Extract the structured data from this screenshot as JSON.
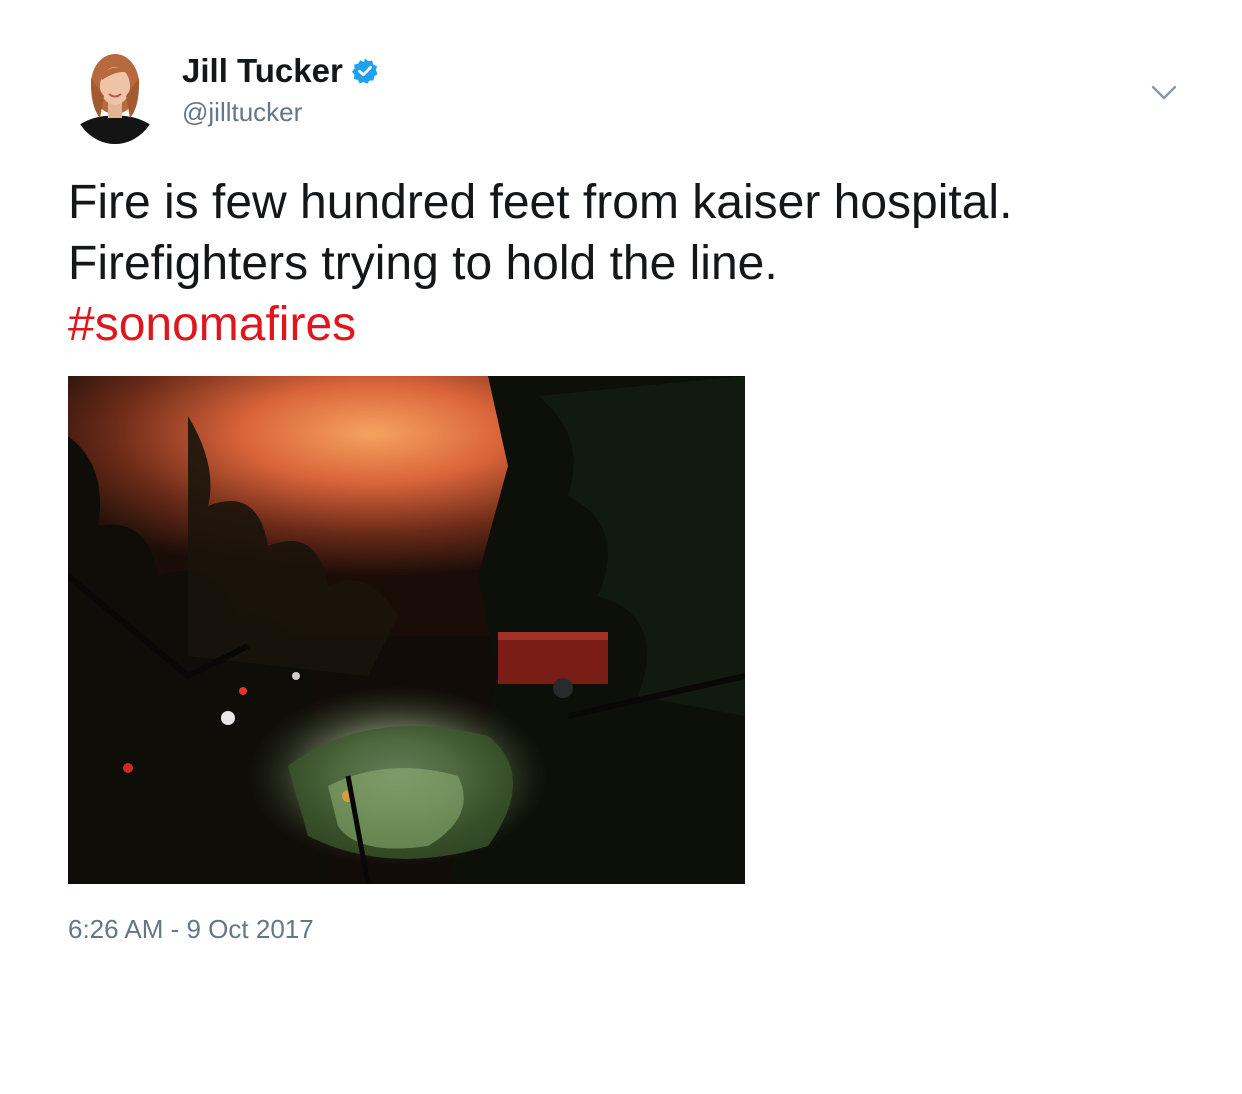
{
  "author": {
    "name": "Jill Tucker",
    "handle": "@jilltucker",
    "verified": true
  },
  "tweet": {
    "line1": "Fire is few hundred feet from kaiser hospital.",
    "line2": "Firefighters trying to hold the line.",
    "hashtag": "#sonomafires",
    "timestamp": "6:26 AM - 9 Oct 2017"
  },
  "icons": {
    "verified": "verified-badge-icon",
    "menu": "chevron-down-icon"
  },
  "colors": {
    "hashtag": "#e0161d",
    "verified": "#1da1f2",
    "secondary_text": "#657786",
    "primary_text": "#14171a"
  }
}
